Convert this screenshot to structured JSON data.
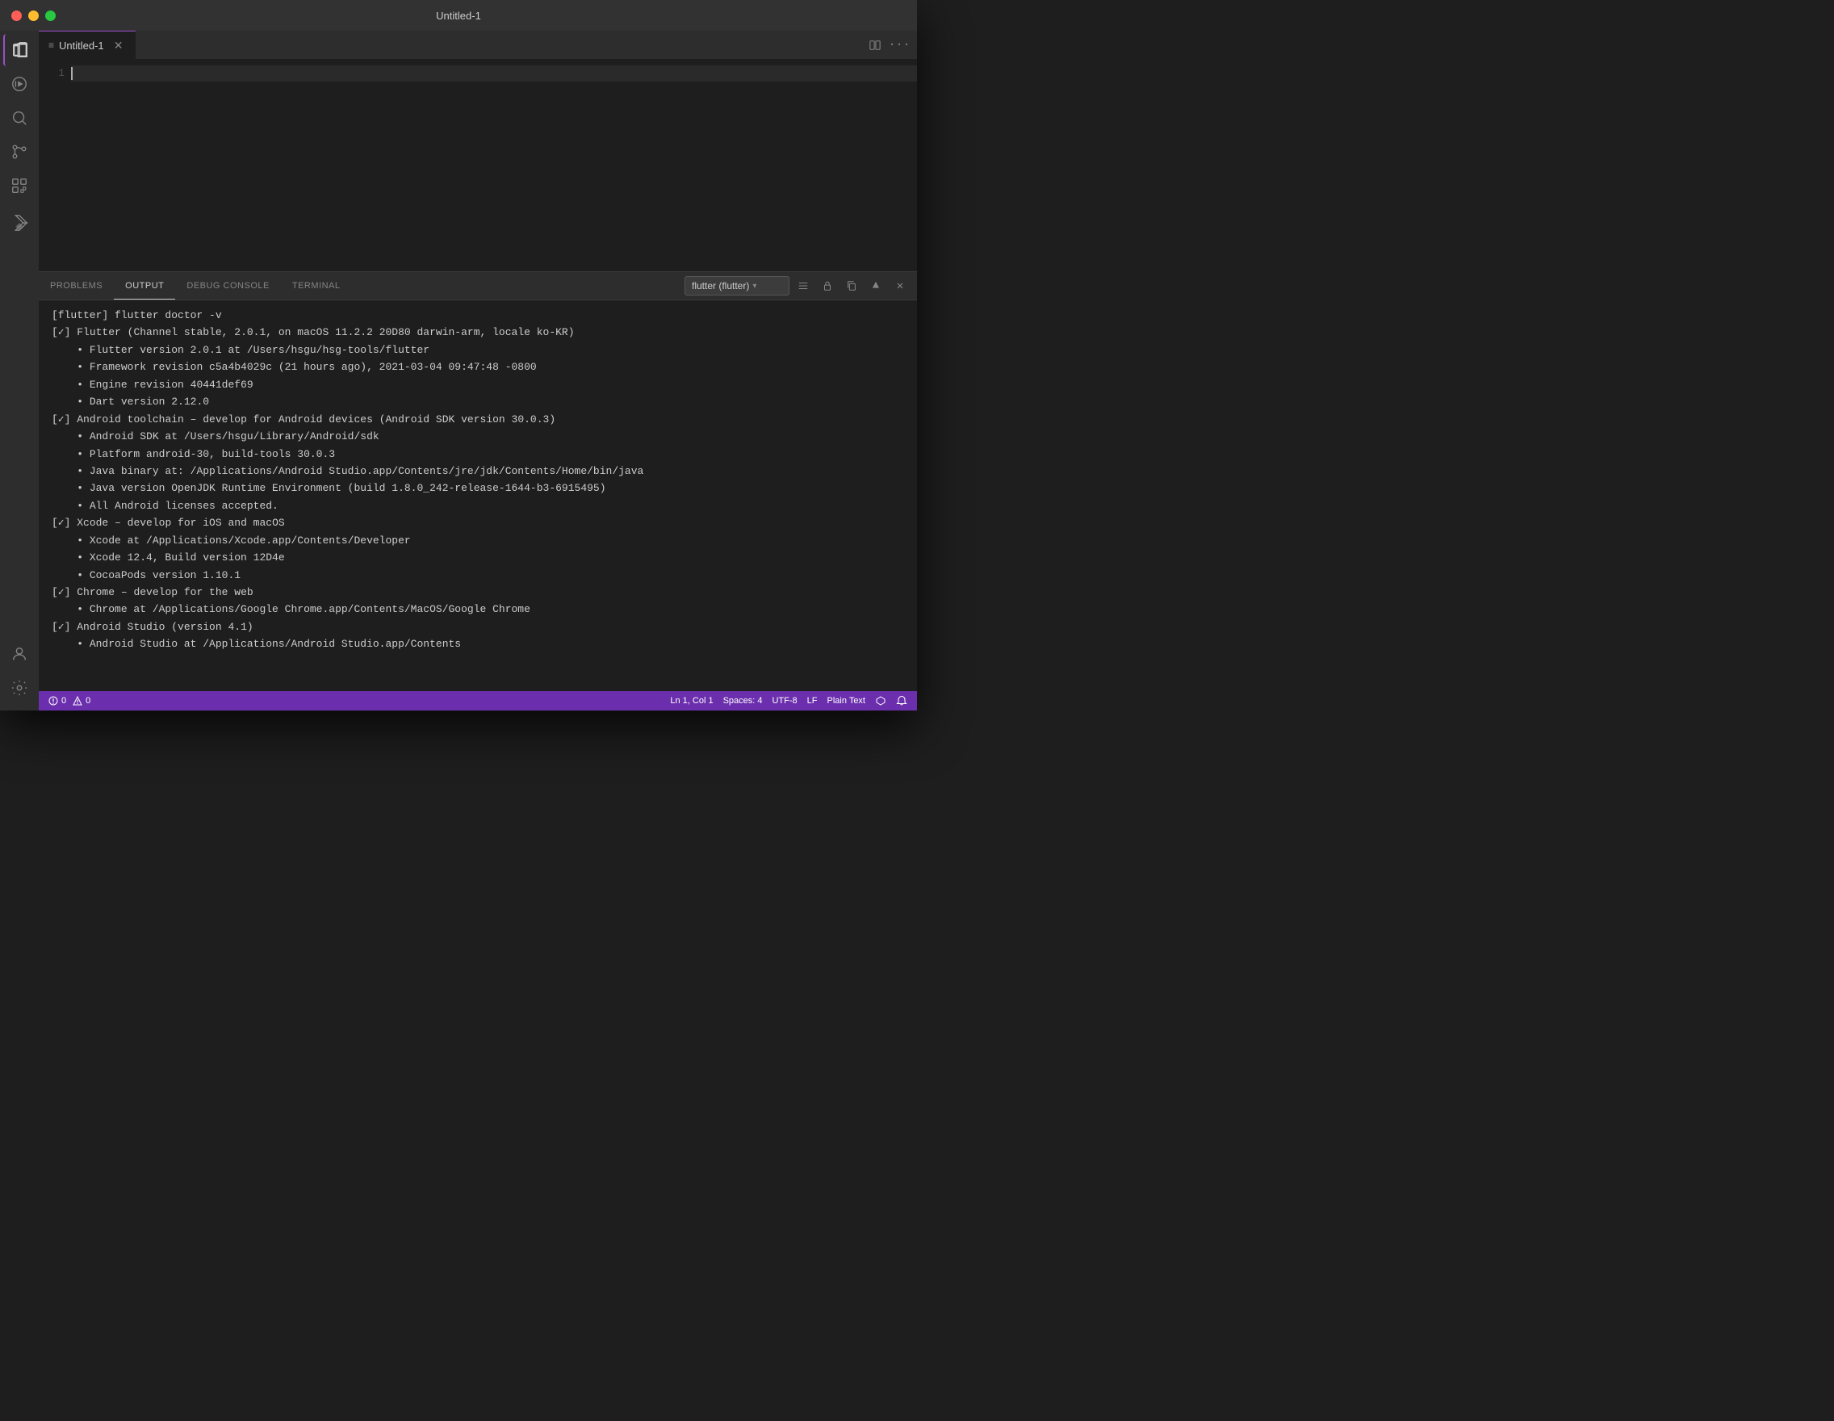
{
  "titlebar": {
    "title": "Untitled-1"
  },
  "tabs": [
    {
      "label": "Untitled-1",
      "icon": "≡",
      "active": true
    }
  ],
  "tabs_actions": {
    "split": "⊞",
    "more": "···"
  },
  "editor": {
    "lines": [
      "1"
    ],
    "content": ""
  },
  "panel": {
    "tabs": [
      {
        "label": "PROBLEMS"
      },
      {
        "label": "OUTPUT",
        "active": true
      },
      {
        "label": "DEBUG CONSOLE"
      },
      {
        "label": "TERMINAL"
      }
    ],
    "dropdown_label": "flutter (flutter)",
    "output_lines": [
      {
        "text": "[flutter] flutter doctor -v",
        "cls": "cmd"
      },
      {
        "text": "[✓] Flutter (Channel stable, 2.0.1, on macOS 11.2.2 20D80 darwin-arm, locale ko-KR)",
        "cls": "info"
      },
      {
        "text": "    • Flutter version 2.0.1 at /Users/hsgu/hsg-tools/flutter",
        "indent": true
      },
      {
        "text": "    • Framework revision c5a4b4029c (21 hours ago), 2021-03-04 09:47:48 -0800",
        "indent": true
      },
      {
        "text": "    • Engine revision 40441def69",
        "indent": true
      },
      {
        "text": "    • Dart version 2.12.0",
        "indent": true
      },
      {
        "text": ""
      },
      {
        "text": "[✓] Android toolchain – develop for Android devices (Android SDK version 30.0.3)",
        "cls": "info"
      },
      {
        "text": "    • Android SDK at /Users/hsgu/Library/Android/sdk",
        "indent": true
      },
      {
        "text": "    • Platform android-30, build-tools 30.0.3",
        "indent": true
      },
      {
        "text": "    • Java binary at: /Applications/Android Studio.app/Contents/jre/jdk/Contents/Home/bin/java",
        "indent": true
      },
      {
        "text": "    • Java version OpenJDK Runtime Environment (build 1.8.0_242-release-1644-b3-6915495)",
        "indent": true
      },
      {
        "text": "    • All Android licenses accepted.",
        "indent": true
      },
      {
        "text": ""
      },
      {
        "text": "[✓] Xcode – develop for iOS and macOS",
        "cls": "info"
      },
      {
        "text": "    • Xcode at /Applications/Xcode.app/Contents/Developer",
        "indent": true
      },
      {
        "text": "    • Xcode 12.4, Build version 12D4e",
        "indent": true
      },
      {
        "text": "    • CocoaPods version 1.10.1",
        "indent": true
      },
      {
        "text": ""
      },
      {
        "text": "[✓] Chrome – develop for the web",
        "cls": "info"
      },
      {
        "text": "    • Chrome at /Applications/Google Chrome.app/Contents/MacOS/Google Chrome",
        "indent": true
      },
      {
        "text": ""
      },
      {
        "text": "[✓] Android Studio (version 4.1)",
        "cls": "info"
      },
      {
        "text": "    • Android Studio at /Applications/Android Studio.app/Contents",
        "indent": true
      }
    ]
  },
  "statusbar": {
    "errors": "0",
    "warnings": "0",
    "position": "Ln 1, Col 1",
    "spaces": "Spaces: 4",
    "encoding": "UTF-8",
    "eol": "LF",
    "language": "Plain Text",
    "remote_icon": "⎇",
    "bell_icon": "🔔"
  },
  "sidebar": {
    "icons": [
      {
        "name": "explorer",
        "title": "Explorer"
      },
      {
        "name": "run",
        "title": "Run and Debug"
      },
      {
        "name": "search",
        "title": "Search"
      },
      {
        "name": "source-control",
        "title": "Source Control"
      },
      {
        "name": "extensions",
        "title": "Extensions"
      },
      {
        "name": "flutter",
        "title": "Flutter"
      }
    ],
    "bottom_icons": [
      {
        "name": "account",
        "title": "Account"
      },
      {
        "name": "settings",
        "title": "Settings"
      }
    ]
  }
}
